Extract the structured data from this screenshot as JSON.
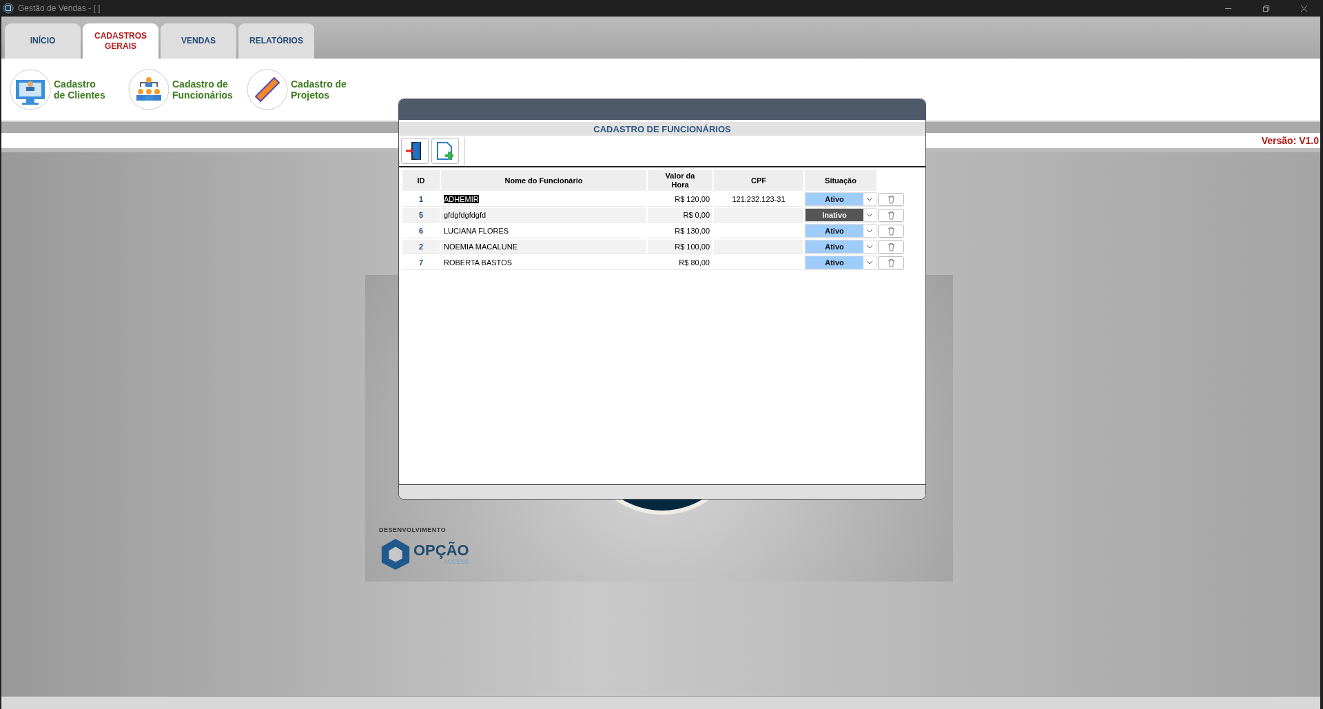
{
  "window": {
    "title": "Gestão de Vendas - [ ]"
  },
  "tabs": [
    {
      "label": "INÍCIO",
      "selected": false
    },
    {
      "label": "CADASTROS\nGERAIS",
      "selected": true
    },
    {
      "label": "VENDAS",
      "selected": false
    },
    {
      "label": "RELATÓRIOS",
      "selected": false
    }
  ],
  "ribbon": [
    {
      "kind": "clients",
      "label": "Cadastro\nde Clientes"
    },
    {
      "kind": "employees",
      "label": "Cadastro de\nFuncionários"
    },
    {
      "kind": "projects",
      "label": "Cadastro de\nProjetos"
    }
  ],
  "version": "Versão: V1.0",
  "splash": {
    "caption": "DESENVOLVIMENTO",
    "brand": "OPÇÃO",
    "sub": "ACCESS"
  },
  "dialog": {
    "title": "CADASTRO DE FUNCIONÁRIOS",
    "columns": [
      "ID",
      "Nome do Funcionário",
      "Valor da\nHora",
      "CPF",
      "Situação"
    ],
    "rows": [
      {
        "id": "1",
        "name": "ADHEMIR",
        "rate": "R$ 120,00",
        "cpf": "121.232.123-31",
        "status": "Ativo",
        "active": true,
        "selected": true
      },
      {
        "id": "5",
        "name": "gfdgfdgfdgfd",
        "rate": "R$ 0,00",
        "status": "Inativo",
        "active": false,
        "selected": false
      },
      {
        "id": "6",
        "name": "LUCIANA FLORES",
        "rate": "R$ 130,00",
        "status": "Ativo",
        "active": true,
        "selected": false
      },
      {
        "id": "2",
        "name": "NOEMIA MACALUNE",
        "rate": "R$ 100,00",
        "status": "Ativo",
        "active": true,
        "selected": false
      },
      {
        "id": "7",
        "name": "ROBERTA BASTOS",
        "rate": "R$ 80,00",
        "status": "Ativo",
        "active": true,
        "selected": false
      }
    ]
  }
}
